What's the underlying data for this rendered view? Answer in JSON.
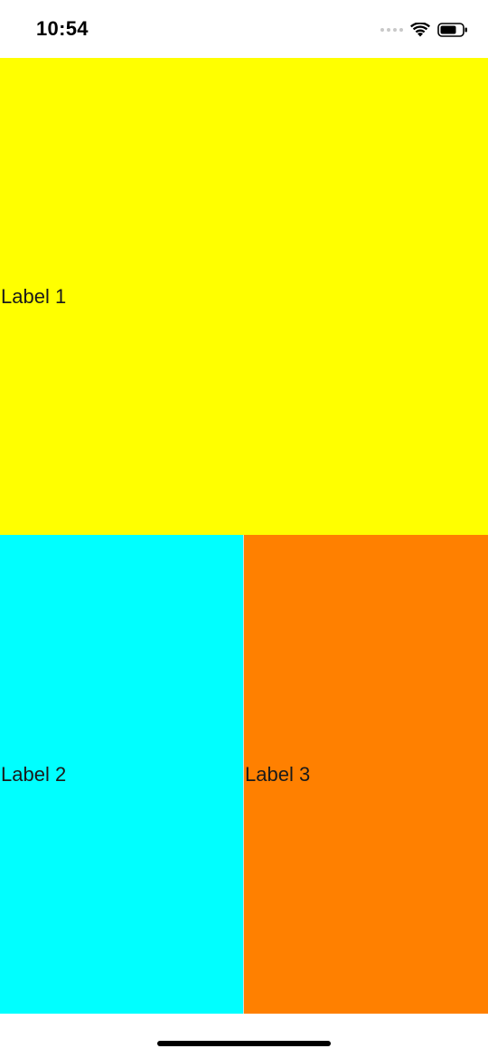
{
  "status_bar": {
    "time": "10:54",
    "icons": [
      "signal-dots-icon",
      "wifi-icon",
      "battery-icon"
    ]
  },
  "panels": {
    "top": {
      "label": "Label 1",
      "color": "#FFFF00"
    },
    "bottom_left": {
      "label": "Label 2",
      "color": "#00FFFF"
    },
    "bottom_right": {
      "label": "Label 3",
      "color": "#FF8000"
    }
  },
  "home_indicator": {
    "color": "#000000"
  }
}
